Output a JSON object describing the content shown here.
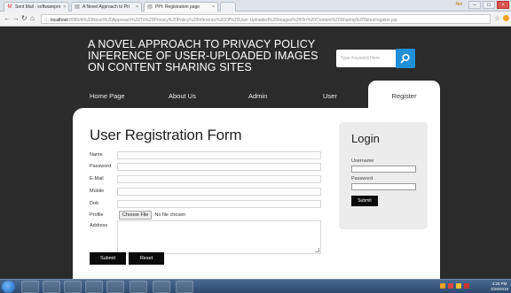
{
  "browser": {
    "tabs": [
      {
        "title": "Sent Mail - softwarepro",
        "icon": "gmail-icon"
      },
      {
        "title": "A Novel Approach to Pri",
        "icon": "document-icon"
      },
      {
        "title": "PPI: Registration page",
        "icon": "document-icon"
      }
    ],
    "user_label": "Nei",
    "url_prefix": "localhost",
    "url": ":8080/A%20Novel%20Approach%20To%20Privacy%20Policy%20Inference%20Of%20User-Uploaded%20Images%20On%20Content%20Sharing%20Sites/register.jsp"
  },
  "site": {
    "title": "A NOVEL APPROACH TO PRIVACY POLICY INFERENCE OF USER-UPLOADED IMAGES ON CONTENT SHARING SITES",
    "search_placeholder": "Type Keyword Here"
  },
  "nav": {
    "home": "Home Page",
    "about": "About Us",
    "admin": "Admin",
    "user": "User",
    "register": "Register"
  },
  "form": {
    "title": "User Registration Form",
    "labels": {
      "name": "Name",
      "password": "Password",
      "email": "E-Mail",
      "mobile": "Mobile",
      "dob": "Dob",
      "profile": "Profile",
      "address": "Address"
    },
    "file_button": "Choose File",
    "file_status": "No file chosen",
    "submit": "Submit",
    "reset": "Reset"
  },
  "login": {
    "title": "Login",
    "username_label": "Username",
    "password_label": "Password",
    "submit": "Submit"
  },
  "taskbar": {
    "time": "4:26 PM",
    "date": "3/29/2018"
  },
  "colors": {
    "accent": "#1f8fd8",
    "page_bg": "#2b2b2b",
    "button_bg": "#0a0a0a"
  }
}
